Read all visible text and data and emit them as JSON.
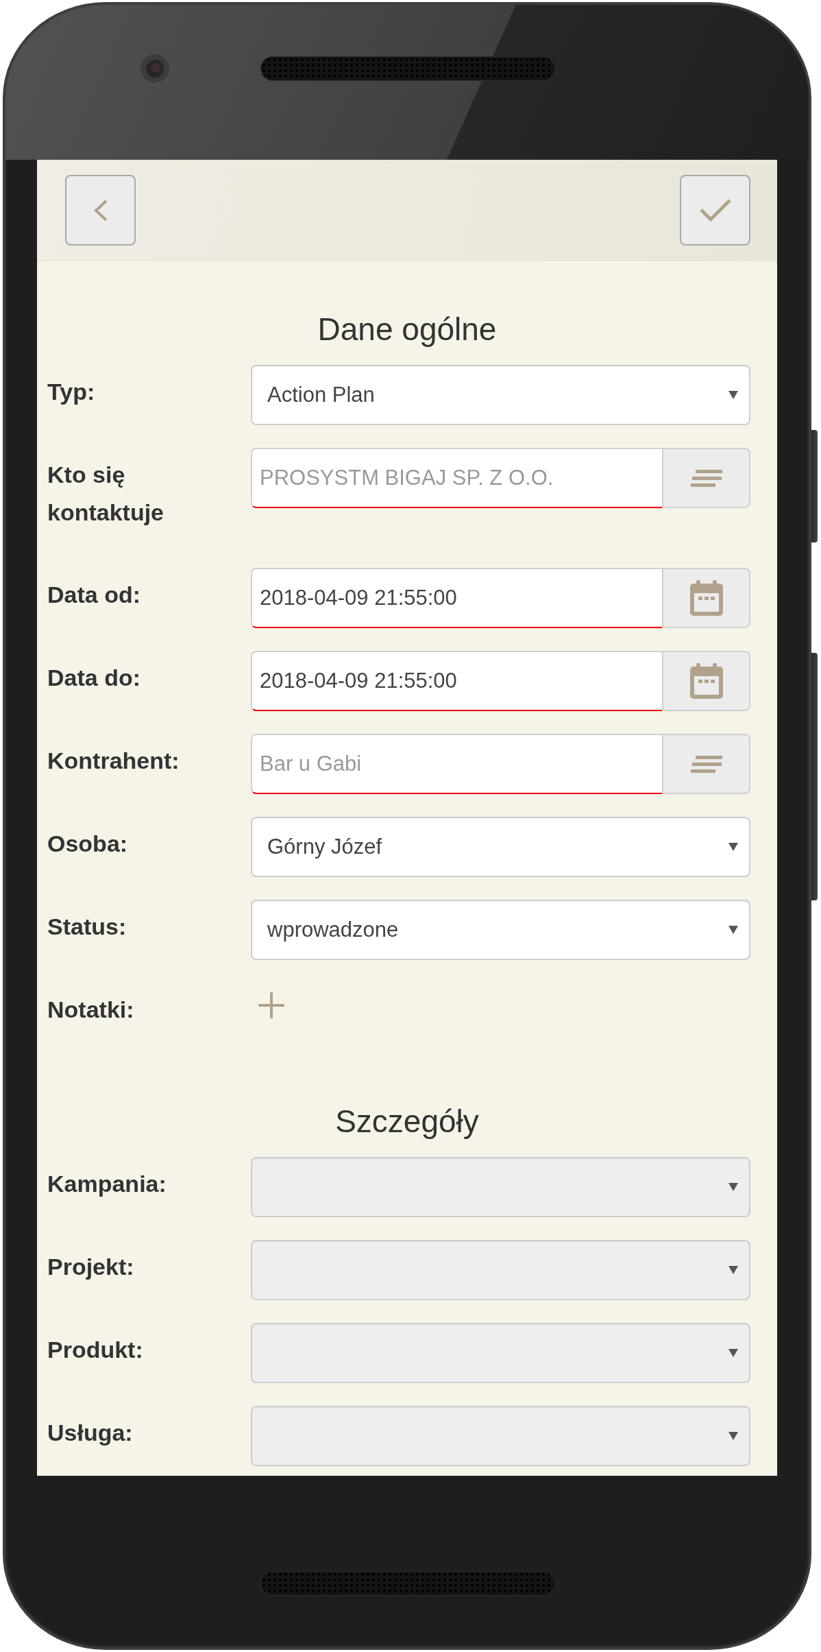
{
  "sections": [
    {
      "title": "Dane ogólne",
      "fields": [
        {
          "kind": "select",
          "label": "Typ:",
          "value": "Action Plan",
          "disabled": false,
          "required": false
        },
        {
          "kind": "lookup",
          "label": "Kto się kontaktuje",
          "placeholder": "PROSYSTM BIGAJ SP. Z O.O.",
          "disabled": false,
          "required": true
        },
        {
          "kind": "date",
          "label": "Data od:",
          "value": "2018-04-09 21:55:00",
          "disabled": false,
          "required": true
        },
        {
          "kind": "date",
          "label": "Data do:",
          "value": "2018-04-09 21:55:00",
          "disabled": false,
          "required": true
        },
        {
          "kind": "lookup",
          "label": "Kontrahent:",
          "placeholder": "Bar u Gabi",
          "disabled": false,
          "required": true
        },
        {
          "kind": "select",
          "label": "Osoba:",
          "value": "Górny Józef",
          "disabled": false,
          "required": false
        },
        {
          "kind": "select",
          "label": "Status:",
          "value": "wprowadzone",
          "disabled": false,
          "required": false
        },
        {
          "kind": "add",
          "label": "Notatki:",
          "disabled": false,
          "required": false
        }
      ]
    },
    {
      "title": "Szczegóły",
      "fields": [
        {
          "kind": "select",
          "label": "Kampania:",
          "disabled": true,
          "required": false
        },
        {
          "kind": "select",
          "label": "Projekt:",
          "disabled": true,
          "required": false
        },
        {
          "kind": "select",
          "label": "Produkt:",
          "disabled": true,
          "required": false
        },
        {
          "kind": "select",
          "label": "Usługa:",
          "disabled": true,
          "required": false
        }
      ]
    }
  ]
}
